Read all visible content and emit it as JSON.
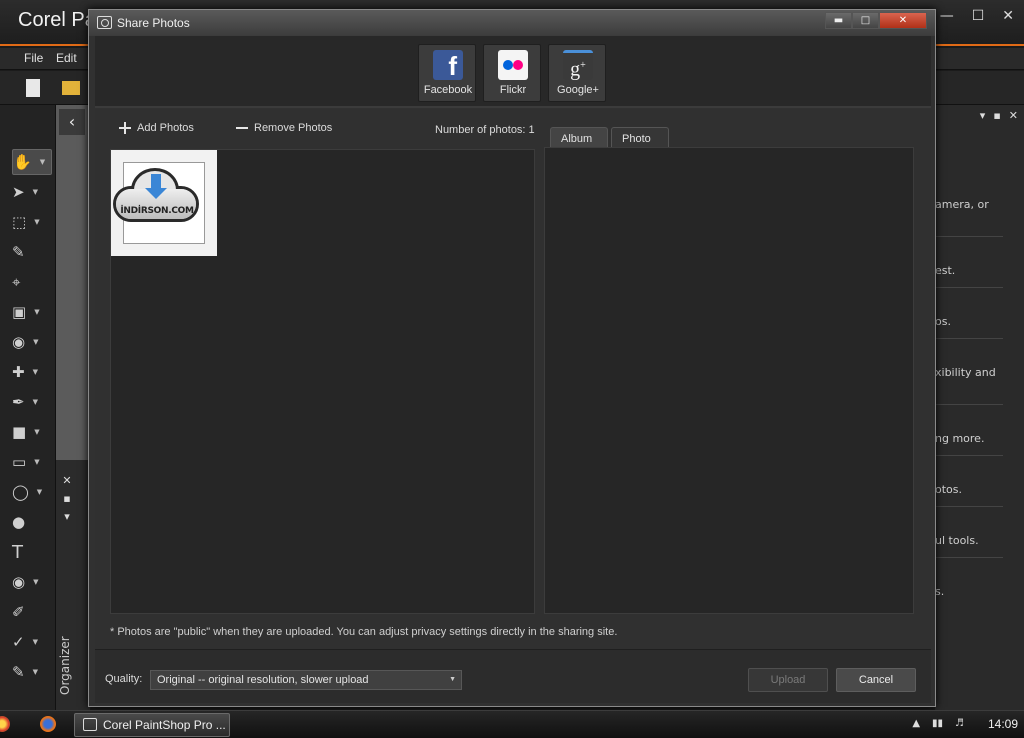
{
  "app": {
    "title": "Corel Pa",
    "menu": [
      "File",
      "Edit"
    ],
    "organizer_label": "Organizer"
  },
  "right_panel": {
    "items": [
      "amera, or",
      "est.",
      "os.",
      "xibility and",
      "ng more.",
      "otos.",
      "ul tools.",
      "s."
    ]
  },
  "dialog": {
    "title": "Share Photos",
    "share_buttons": [
      {
        "label": "Facebook",
        "icon": "facebook-logo-icon",
        "color": "#3b5998"
      },
      {
        "label": "Flickr",
        "icon": "flickr-logo-icon",
        "color": "#ff0084"
      },
      {
        "label": "Google+",
        "icon": "google-plus-logo-icon",
        "color": "#4a90d9"
      }
    ],
    "add_photos": "Add Photos",
    "remove_photos": "Remove Photos",
    "photo_count_text": "Number of photos: 1",
    "thumbnail_brand": "İNDİRSON.COM",
    "tabs": [
      "Album",
      "Photo"
    ],
    "footnote": "* Photos are \"public\" when they are uploaded. You can adjust privacy settings directly in the sharing site.",
    "quality_label": "Quality:",
    "quality_value": "Original -- original resolution, slower upload",
    "upload_label": "Upload",
    "cancel_label": "Cancel"
  },
  "taskbar": {
    "task_label": "Corel PaintShop Pro ...",
    "clock": "14:09"
  },
  "colors": {
    "accent": "#e06a16",
    "close_button": "#c0402a"
  }
}
